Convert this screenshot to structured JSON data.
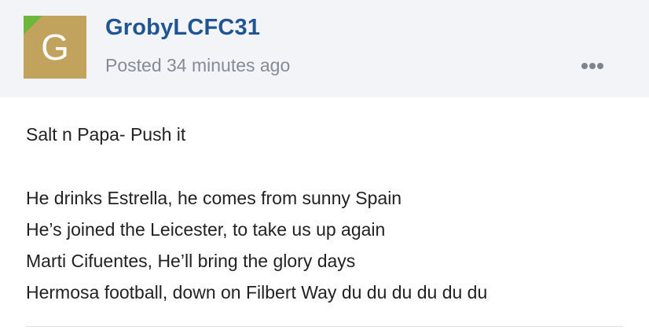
{
  "post": {
    "author": {
      "avatar_letter": "G",
      "name": "GrobyLCFC31"
    },
    "meta": "Posted 34 minutes ago",
    "menu_icon": "more-dots-icon",
    "lines": [
      "Salt n Papa- Push it",
      "He drinks Estrella, he comes from sunny Spain",
      "He’s joined the Leicester, to take us up again",
      "Marti Cifuentes, He’ll bring the glory days",
      "Hermosa football, down on Filbert Way du du du du du du"
    ]
  },
  "colors": {
    "header_bg": "#f3f4f8",
    "avatar_bg": "#c2a35d",
    "avatar_flag": "#6fb63c",
    "author_name": "#1f5592",
    "meta_text": "#858b96",
    "body_text": "#222222"
  }
}
